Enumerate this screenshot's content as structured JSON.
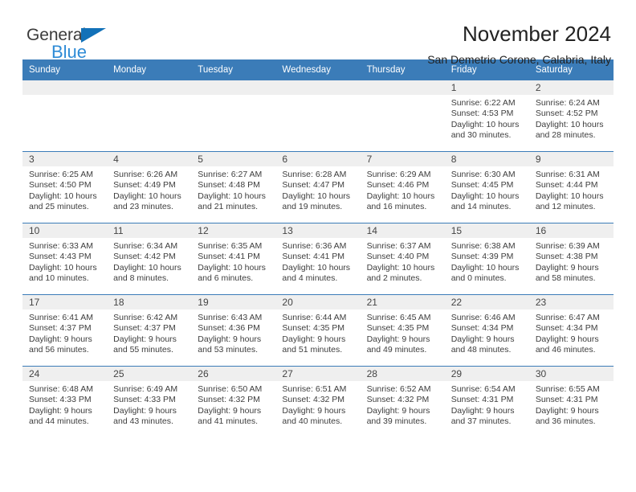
{
  "brand": {
    "name_top": "General",
    "name_bottom": "Blue",
    "triangle_color": "#1271b8",
    "blue_color": "#2e8bd6"
  },
  "header": {
    "title": "November 2024",
    "subtitle": "San Demetrio Corone, Calabria, Italy"
  },
  "theme": {
    "header_blue": "#3b7cb8",
    "date_strip_gray": "#efefef",
    "text_color": "#3d3d3d"
  },
  "weekday_headers": [
    "Sunday",
    "Monday",
    "Tuesday",
    "Wednesday",
    "Thursday",
    "Friday",
    "Saturday"
  ],
  "labels": {
    "sunrise_prefix": "Sunrise:",
    "sunset_prefix": "Sunset:",
    "daylight_prefix": "Daylight:"
  },
  "weeks": [
    [
      {
        "date": "",
        "empty": true
      },
      {
        "date": "",
        "empty": true
      },
      {
        "date": "",
        "empty": true
      },
      {
        "date": "",
        "empty": true
      },
      {
        "date": "",
        "empty": true
      },
      {
        "date": "1",
        "sunrise": "Sunrise: 6:22 AM",
        "sunset": "Sunset: 4:53 PM",
        "daylight": "Daylight: 10 hours and 30 minutes."
      },
      {
        "date": "2",
        "sunrise": "Sunrise: 6:24 AM",
        "sunset": "Sunset: 4:52 PM",
        "daylight": "Daylight: 10 hours and 28 minutes."
      }
    ],
    [
      {
        "date": "3",
        "sunrise": "Sunrise: 6:25 AM",
        "sunset": "Sunset: 4:50 PM",
        "daylight": "Daylight: 10 hours and 25 minutes."
      },
      {
        "date": "4",
        "sunrise": "Sunrise: 6:26 AM",
        "sunset": "Sunset: 4:49 PM",
        "daylight": "Daylight: 10 hours and 23 minutes."
      },
      {
        "date": "5",
        "sunrise": "Sunrise: 6:27 AM",
        "sunset": "Sunset: 4:48 PM",
        "daylight": "Daylight: 10 hours and 21 minutes."
      },
      {
        "date": "6",
        "sunrise": "Sunrise: 6:28 AM",
        "sunset": "Sunset: 4:47 PM",
        "daylight": "Daylight: 10 hours and 19 minutes."
      },
      {
        "date": "7",
        "sunrise": "Sunrise: 6:29 AM",
        "sunset": "Sunset: 4:46 PM",
        "daylight": "Daylight: 10 hours and 16 minutes."
      },
      {
        "date": "8",
        "sunrise": "Sunrise: 6:30 AM",
        "sunset": "Sunset: 4:45 PM",
        "daylight": "Daylight: 10 hours and 14 minutes."
      },
      {
        "date": "9",
        "sunrise": "Sunrise: 6:31 AM",
        "sunset": "Sunset: 4:44 PM",
        "daylight": "Daylight: 10 hours and 12 minutes."
      }
    ],
    [
      {
        "date": "10",
        "sunrise": "Sunrise: 6:33 AM",
        "sunset": "Sunset: 4:43 PM",
        "daylight": "Daylight: 10 hours and 10 minutes."
      },
      {
        "date": "11",
        "sunrise": "Sunrise: 6:34 AM",
        "sunset": "Sunset: 4:42 PM",
        "daylight": "Daylight: 10 hours and 8 minutes."
      },
      {
        "date": "12",
        "sunrise": "Sunrise: 6:35 AM",
        "sunset": "Sunset: 4:41 PM",
        "daylight": "Daylight: 10 hours and 6 minutes."
      },
      {
        "date": "13",
        "sunrise": "Sunrise: 6:36 AM",
        "sunset": "Sunset: 4:41 PM",
        "daylight": "Daylight: 10 hours and 4 minutes."
      },
      {
        "date": "14",
        "sunrise": "Sunrise: 6:37 AM",
        "sunset": "Sunset: 4:40 PM",
        "daylight": "Daylight: 10 hours and 2 minutes."
      },
      {
        "date": "15",
        "sunrise": "Sunrise: 6:38 AM",
        "sunset": "Sunset: 4:39 PM",
        "daylight": "Daylight: 10 hours and 0 minutes."
      },
      {
        "date": "16",
        "sunrise": "Sunrise: 6:39 AM",
        "sunset": "Sunset: 4:38 PM",
        "daylight": "Daylight: 9 hours and 58 minutes."
      }
    ],
    [
      {
        "date": "17",
        "sunrise": "Sunrise: 6:41 AM",
        "sunset": "Sunset: 4:37 PM",
        "daylight": "Daylight: 9 hours and 56 minutes."
      },
      {
        "date": "18",
        "sunrise": "Sunrise: 6:42 AM",
        "sunset": "Sunset: 4:37 PM",
        "daylight": "Daylight: 9 hours and 55 minutes."
      },
      {
        "date": "19",
        "sunrise": "Sunrise: 6:43 AM",
        "sunset": "Sunset: 4:36 PM",
        "daylight": "Daylight: 9 hours and 53 minutes."
      },
      {
        "date": "20",
        "sunrise": "Sunrise: 6:44 AM",
        "sunset": "Sunset: 4:35 PM",
        "daylight": "Daylight: 9 hours and 51 minutes."
      },
      {
        "date": "21",
        "sunrise": "Sunrise: 6:45 AM",
        "sunset": "Sunset: 4:35 PM",
        "daylight": "Daylight: 9 hours and 49 minutes."
      },
      {
        "date": "22",
        "sunrise": "Sunrise: 6:46 AM",
        "sunset": "Sunset: 4:34 PM",
        "daylight": "Daylight: 9 hours and 48 minutes."
      },
      {
        "date": "23",
        "sunrise": "Sunrise: 6:47 AM",
        "sunset": "Sunset: 4:34 PM",
        "daylight": "Daylight: 9 hours and 46 minutes."
      }
    ],
    [
      {
        "date": "24",
        "sunrise": "Sunrise: 6:48 AM",
        "sunset": "Sunset: 4:33 PM",
        "daylight": "Daylight: 9 hours and 44 minutes."
      },
      {
        "date": "25",
        "sunrise": "Sunrise: 6:49 AM",
        "sunset": "Sunset: 4:33 PM",
        "daylight": "Daylight: 9 hours and 43 minutes."
      },
      {
        "date": "26",
        "sunrise": "Sunrise: 6:50 AM",
        "sunset": "Sunset: 4:32 PM",
        "daylight": "Daylight: 9 hours and 41 minutes."
      },
      {
        "date": "27",
        "sunrise": "Sunrise: 6:51 AM",
        "sunset": "Sunset: 4:32 PM",
        "daylight": "Daylight: 9 hours and 40 minutes."
      },
      {
        "date": "28",
        "sunrise": "Sunrise: 6:52 AM",
        "sunset": "Sunset: 4:32 PM",
        "daylight": "Daylight: 9 hours and 39 minutes."
      },
      {
        "date": "29",
        "sunrise": "Sunrise: 6:54 AM",
        "sunset": "Sunset: 4:31 PM",
        "daylight": "Daylight: 9 hours and 37 minutes."
      },
      {
        "date": "30",
        "sunrise": "Sunrise: 6:55 AM",
        "sunset": "Sunset: 4:31 PM",
        "daylight": "Daylight: 9 hours and 36 minutes."
      }
    ]
  ]
}
